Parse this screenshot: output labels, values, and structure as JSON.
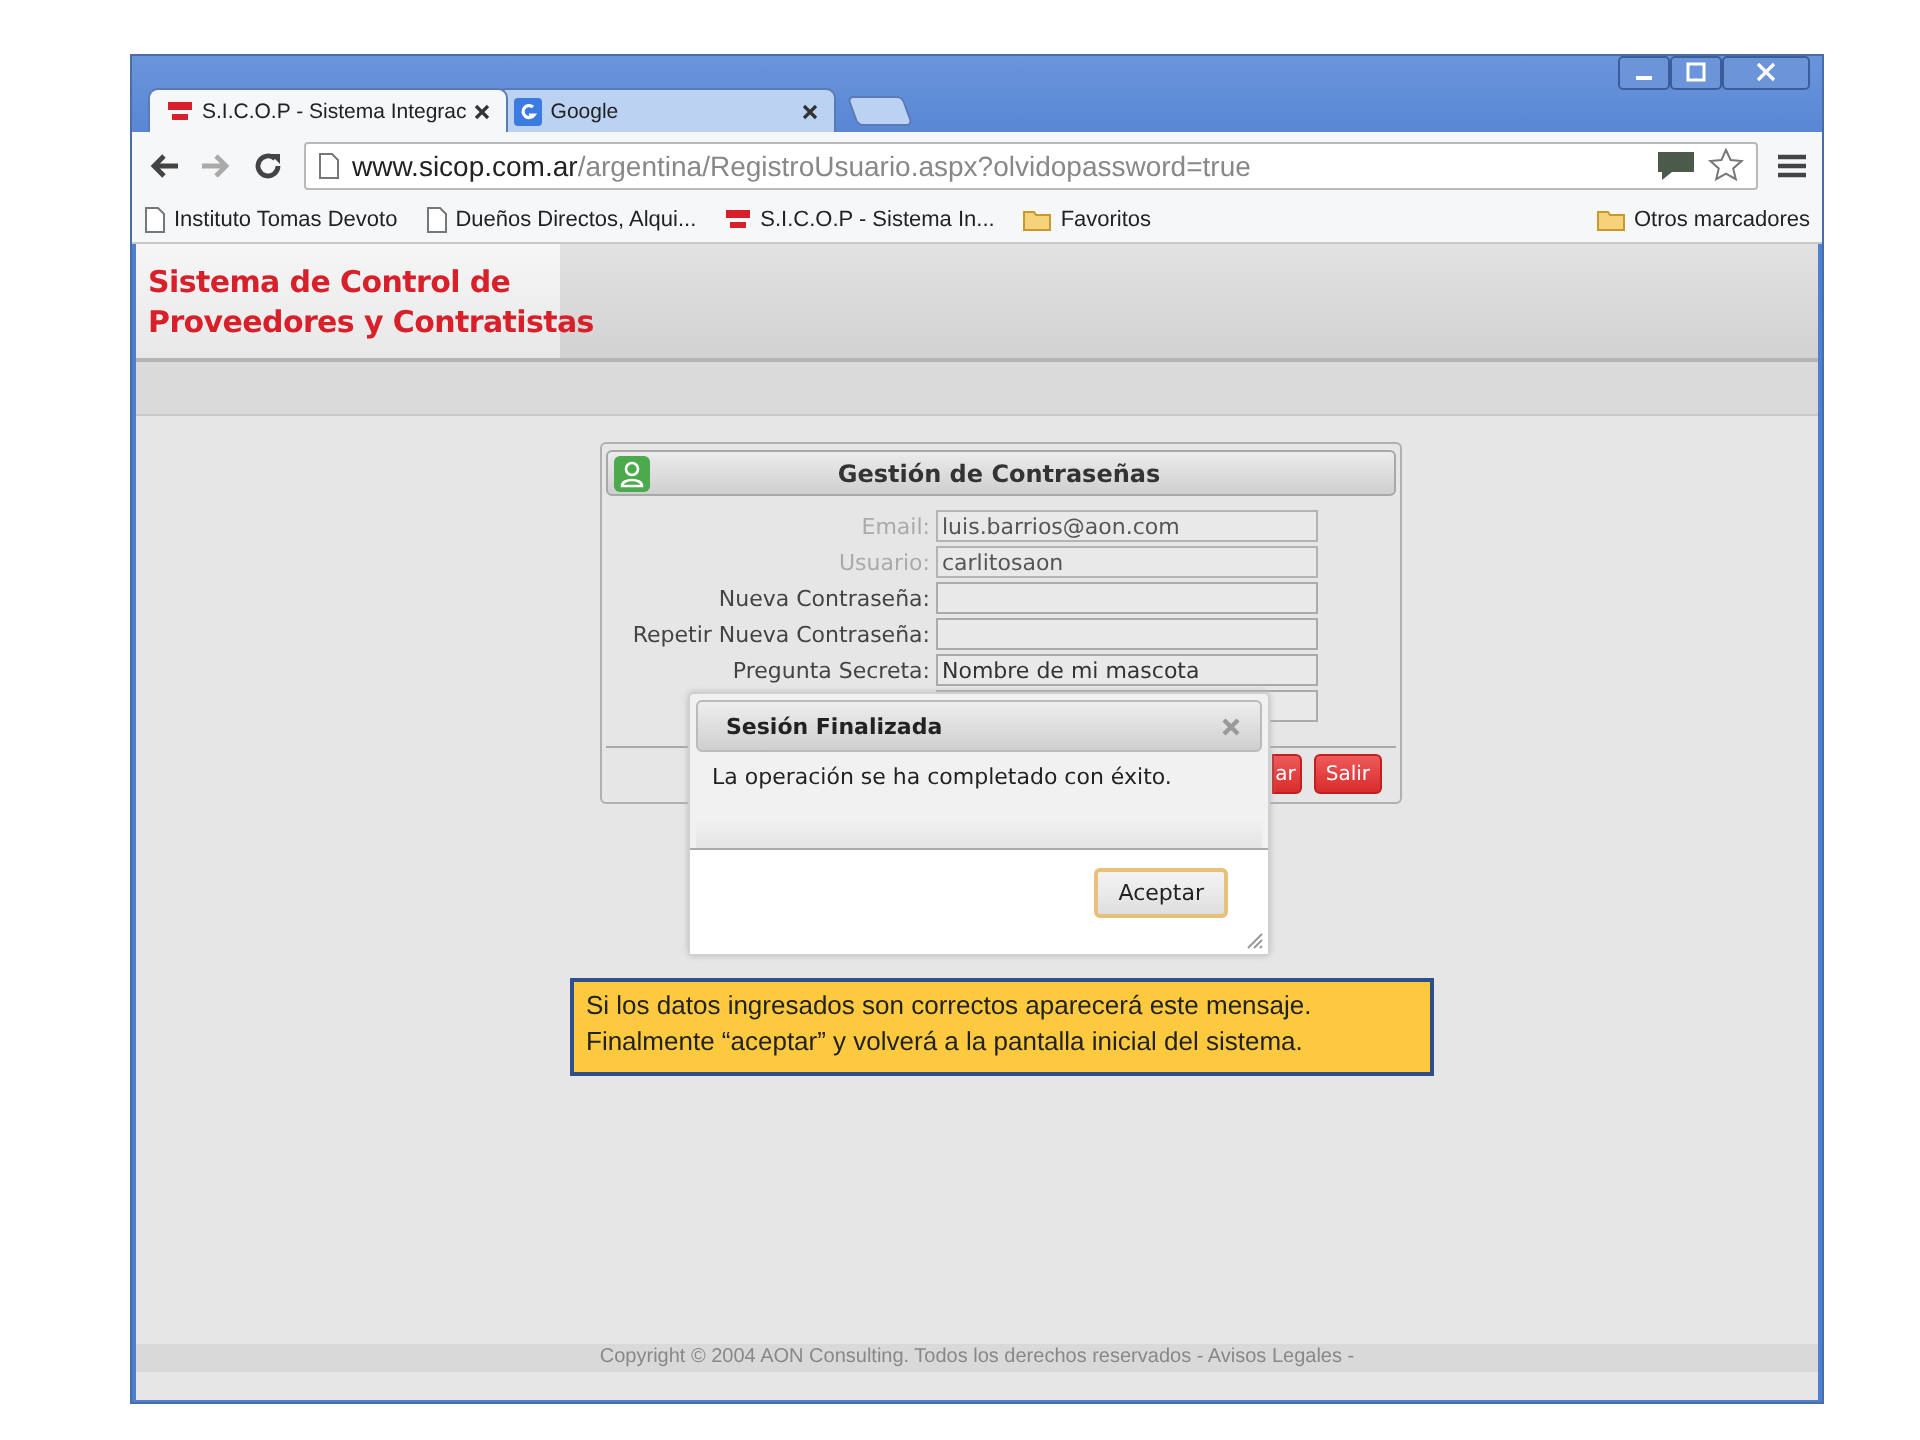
{
  "browser": {
    "tabs": [
      {
        "title": "S.I.C.O.P - Sistema Integrac",
        "kind": "site",
        "selected": true
      },
      {
        "title": "Google",
        "kind": "google",
        "selected": false
      }
    ],
    "url": {
      "host": "www.sicop.com.ar",
      "path": "/argentina/RegistroUsuario.aspx?olvidopassword=true"
    },
    "bookmarks": [
      {
        "label": "Instituto Tomas Devoto",
        "kind": "page"
      },
      {
        "label": "Dueños Directos, Alqui...",
        "kind": "page"
      },
      {
        "label": "S.I.C.O.P - Sistema In...",
        "kind": "site"
      },
      {
        "label": "Favoritos",
        "kind": "folder"
      }
    ],
    "other_bookmarks": {
      "label": "Otros marcadores",
      "kind": "folder"
    }
  },
  "site": {
    "logo_lines": [
      "Sistema de Control de",
      "Proveedores y Contratistas"
    ]
  },
  "form": {
    "title": "Gestión de Contraseñas",
    "fields": [
      {
        "label": "Email:",
        "value": "luis.barrios@aon.com",
        "kind": "locked"
      },
      {
        "label": "Usuario:",
        "value": "carlitosaon",
        "kind": "locked"
      },
      {
        "label": "Nueva Contraseña:",
        "kind": "text"
      },
      {
        "label": "Repetir Nueva Contraseña:",
        "kind": "text"
      },
      {
        "label": "Pregunta Secreta:",
        "value": "Nombre de mi mascota",
        "kind": "text"
      },
      {
        "kind": "text"
      }
    ],
    "buttons": [
      {
        "label": "ar"
      },
      {
        "label": "Salir"
      }
    ]
  },
  "dialog": {
    "title": "Sesión Finalizada",
    "message": "La operación se ha completado con éxito.",
    "button": "Aceptar"
  },
  "note": [
    "Si los datos ingresados son correctos aparecerá este mensaje.",
    "Finalmente  “aceptar” y volverá a la pantalla inicial del sistema."
  ],
  "footer": "Copyright © 2004 AON Consulting. Todos los derechos reservados - Avisos Legales -"
}
